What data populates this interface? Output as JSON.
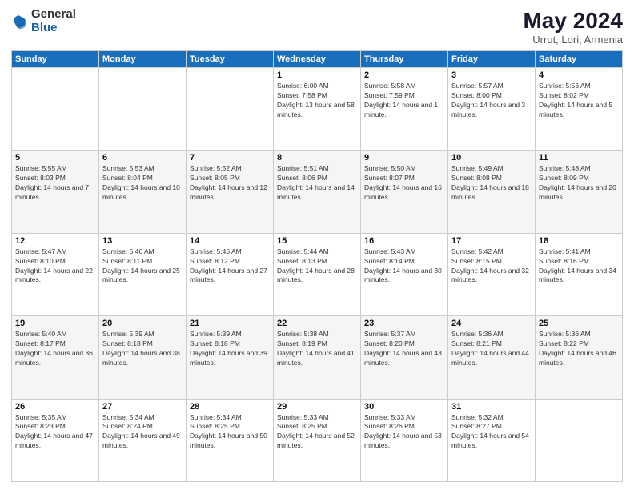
{
  "logo": {
    "general": "General",
    "blue": "Blue"
  },
  "title": {
    "month_year": "May 2024",
    "location": "Urrut, Lori, Armenia"
  },
  "weekdays": [
    "Sunday",
    "Monday",
    "Tuesday",
    "Wednesday",
    "Thursday",
    "Friday",
    "Saturday"
  ],
  "weeks": [
    [
      {
        "day": "",
        "sunrise": "",
        "sunset": "",
        "daylight": ""
      },
      {
        "day": "",
        "sunrise": "",
        "sunset": "",
        "daylight": ""
      },
      {
        "day": "",
        "sunrise": "",
        "sunset": "",
        "daylight": ""
      },
      {
        "day": "1",
        "sunrise": "Sunrise: 6:00 AM",
        "sunset": "Sunset: 7:58 PM",
        "daylight": "Daylight: 13 hours and 58 minutes."
      },
      {
        "day": "2",
        "sunrise": "Sunrise: 5:58 AM",
        "sunset": "Sunset: 7:59 PM",
        "daylight": "Daylight: 14 hours and 1 minute."
      },
      {
        "day": "3",
        "sunrise": "Sunrise: 5:57 AM",
        "sunset": "Sunset: 8:00 PM",
        "daylight": "Daylight: 14 hours and 3 minutes."
      },
      {
        "day": "4",
        "sunrise": "Sunrise: 5:56 AM",
        "sunset": "Sunset: 8:02 PM",
        "daylight": "Daylight: 14 hours and 5 minutes."
      }
    ],
    [
      {
        "day": "5",
        "sunrise": "Sunrise: 5:55 AM",
        "sunset": "Sunset: 8:03 PM",
        "daylight": "Daylight: 14 hours and 7 minutes."
      },
      {
        "day": "6",
        "sunrise": "Sunrise: 5:53 AM",
        "sunset": "Sunset: 8:04 PM",
        "daylight": "Daylight: 14 hours and 10 minutes."
      },
      {
        "day": "7",
        "sunrise": "Sunrise: 5:52 AM",
        "sunset": "Sunset: 8:05 PM",
        "daylight": "Daylight: 14 hours and 12 minutes."
      },
      {
        "day": "8",
        "sunrise": "Sunrise: 5:51 AM",
        "sunset": "Sunset: 8:06 PM",
        "daylight": "Daylight: 14 hours and 14 minutes."
      },
      {
        "day": "9",
        "sunrise": "Sunrise: 5:50 AM",
        "sunset": "Sunset: 8:07 PM",
        "daylight": "Daylight: 14 hours and 16 minutes."
      },
      {
        "day": "10",
        "sunrise": "Sunrise: 5:49 AM",
        "sunset": "Sunset: 8:08 PM",
        "daylight": "Daylight: 14 hours and 18 minutes."
      },
      {
        "day": "11",
        "sunrise": "Sunrise: 5:48 AM",
        "sunset": "Sunset: 8:09 PM",
        "daylight": "Daylight: 14 hours and 20 minutes."
      }
    ],
    [
      {
        "day": "12",
        "sunrise": "Sunrise: 5:47 AM",
        "sunset": "Sunset: 8:10 PM",
        "daylight": "Daylight: 14 hours and 22 minutes."
      },
      {
        "day": "13",
        "sunrise": "Sunrise: 5:46 AM",
        "sunset": "Sunset: 8:11 PM",
        "daylight": "Daylight: 14 hours and 25 minutes."
      },
      {
        "day": "14",
        "sunrise": "Sunrise: 5:45 AM",
        "sunset": "Sunset: 8:12 PM",
        "daylight": "Daylight: 14 hours and 27 minutes."
      },
      {
        "day": "15",
        "sunrise": "Sunrise: 5:44 AM",
        "sunset": "Sunset: 8:13 PM",
        "daylight": "Daylight: 14 hours and 28 minutes."
      },
      {
        "day": "16",
        "sunrise": "Sunrise: 5:43 AM",
        "sunset": "Sunset: 8:14 PM",
        "daylight": "Daylight: 14 hours and 30 minutes."
      },
      {
        "day": "17",
        "sunrise": "Sunrise: 5:42 AM",
        "sunset": "Sunset: 8:15 PM",
        "daylight": "Daylight: 14 hours and 32 minutes."
      },
      {
        "day": "18",
        "sunrise": "Sunrise: 5:41 AM",
        "sunset": "Sunset: 8:16 PM",
        "daylight": "Daylight: 14 hours and 34 minutes."
      }
    ],
    [
      {
        "day": "19",
        "sunrise": "Sunrise: 5:40 AM",
        "sunset": "Sunset: 8:17 PM",
        "daylight": "Daylight: 14 hours and 36 minutes."
      },
      {
        "day": "20",
        "sunrise": "Sunrise: 5:39 AM",
        "sunset": "Sunset: 8:18 PM",
        "daylight": "Daylight: 14 hours and 38 minutes."
      },
      {
        "day": "21",
        "sunrise": "Sunrise: 5:39 AM",
        "sunset": "Sunset: 8:18 PM",
        "daylight": "Daylight: 14 hours and 39 minutes."
      },
      {
        "day": "22",
        "sunrise": "Sunrise: 5:38 AM",
        "sunset": "Sunset: 8:19 PM",
        "daylight": "Daylight: 14 hours and 41 minutes."
      },
      {
        "day": "23",
        "sunrise": "Sunrise: 5:37 AM",
        "sunset": "Sunset: 8:20 PM",
        "daylight": "Daylight: 14 hours and 43 minutes."
      },
      {
        "day": "24",
        "sunrise": "Sunrise: 5:36 AM",
        "sunset": "Sunset: 8:21 PM",
        "daylight": "Daylight: 14 hours and 44 minutes."
      },
      {
        "day": "25",
        "sunrise": "Sunrise: 5:36 AM",
        "sunset": "Sunset: 8:22 PM",
        "daylight": "Daylight: 14 hours and 46 minutes."
      }
    ],
    [
      {
        "day": "26",
        "sunrise": "Sunrise: 5:35 AM",
        "sunset": "Sunset: 8:23 PM",
        "daylight": "Daylight: 14 hours and 47 minutes."
      },
      {
        "day": "27",
        "sunrise": "Sunrise: 5:34 AM",
        "sunset": "Sunset: 8:24 PM",
        "daylight": "Daylight: 14 hours and 49 minutes."
      },
      {
        "day": "28",
        "sunrise": "Sunrise: 5:34 AM",
        "sunset": "Sunset: 8:25 PM",
        "daylight": "Daylight: 14 hours and 50 minutes."
      },
      {
        "day": "29",
        "sunrise": "Sunrise: 5:33 AM",
        "sunset": "Sunset: 8:25 PM",
        "daylight": "Daylight: 14 hours and 52 minutes."
      },
      {
        "day": "30",
        "sunrise": "Sunrise: 5:33 AM",
        "sunset": "Sunset: 8:26 PM",
        "daylight": "Daylight: 14 hours and 53 minutes."
      },
      {
        "day": "31",
        "sunrise": "Sunrise: 5:32 AM",
        "sunset": "Sunset: 8:27 PM",
        "daylight": "Daylight: 14 hours and 54 minutes."
      },
      {
        "day": "",
        "sunrise": "",
        "sunset": "",
        "daylight": ""
      }
    ]
  ]
}
